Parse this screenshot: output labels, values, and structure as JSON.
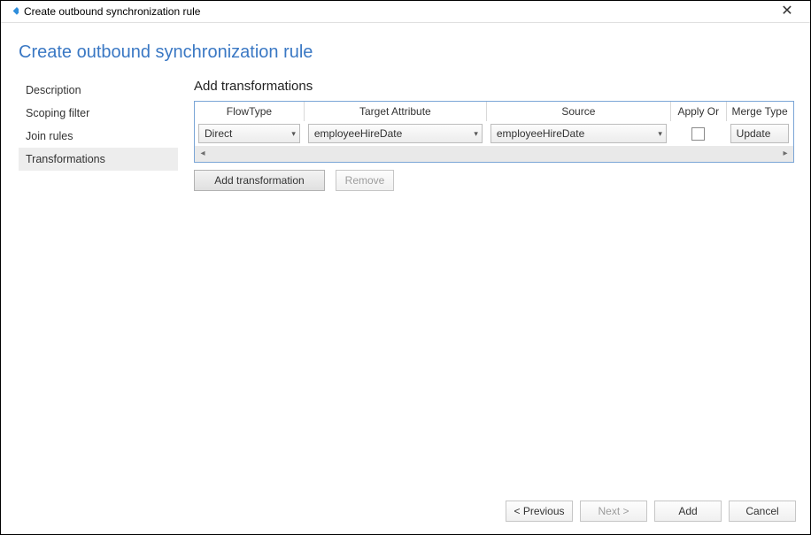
{
  "window": {
    "title": "Create outbound synchronization rule"
  },
  "page": {
    "heading": "Create outbound synchronization rule"
  },
  "sidebar": {
    "items": [
      {
        "label": "Description",
        "active": false
      },
      {
        "label": "Scoping filter",
        "active": false
      },
      {
        "label": "Join rules",
        "active": false
      },
      {
        "label": "Transformations",
        "active": true
      }
    ]
  },
  "section": {
    "title": "Add transformations"
  },
  "grid": {
    "headers": {
      "flowType": "FlowType",
      "targetAttribute": "Target Attribute",
      "source": "Source",
      "applyOr": "Apply Or",
      "mergeType": "Merge Type"
    },
    "rows": [
      {
        "flowType": "Direct",
        "targetAttribute": "employeeHireDate",
        "source": "employeeHireDate",
        "applyOr": false,
        "mergeType": "Update"
      }
    ]
  },
  "actions": {
    "addTransformation": "Add transformation",
    "remove": "Remove"
  },
  "footer": {
    "previous": "< Previous",
    "next": "Next >",
    "add": "Add",
    "cancel": "Cancel"
  }
}
